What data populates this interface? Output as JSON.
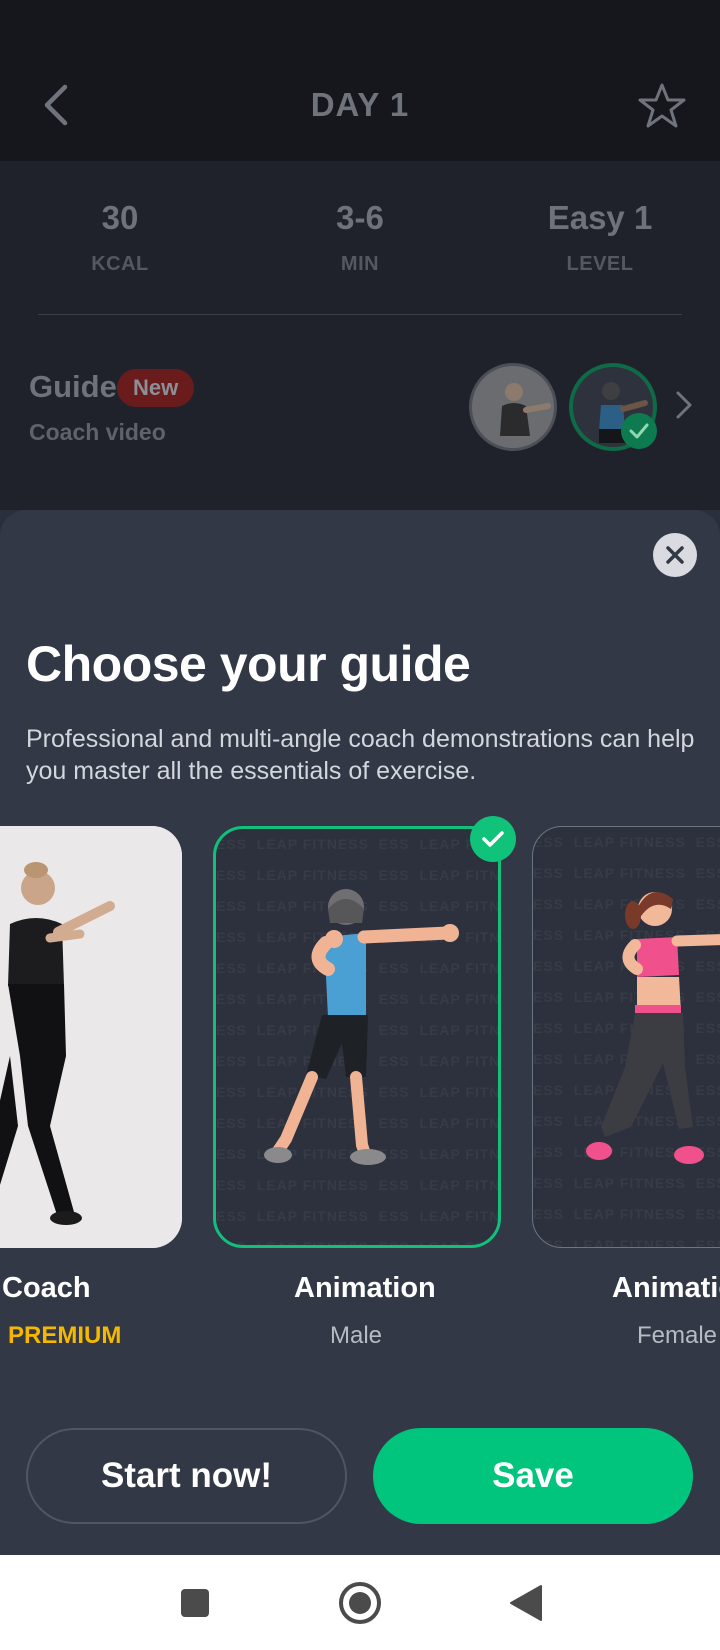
{
  "header": {
    "title": "DAY 1",
    "back_icon": "chevron-left-icon",
    "favorite_icon": "star-outline-icon"
  },
  "stats": [
    {
      "value": "30",
      "label": "KCAL"
    },
    {
      "value": "3-6",
      "label": "MIN"
    },
    {
      "value": "Easy 1",
      "label": "LEVEL"
    }
  ],
  "guide": {
    "title": "Guide",
    "badge": "New",
    "subtitle": "Coach video"
  },
  "sheet": {
    "title": "Choose your guide",
    "description": "Professional and multi-angle coach demonstrations can help you master all the essentials of exercise.",
    "watermark_text": "LEAP FITNESS",
    "options": [
      {
        "title": "Coach",
        "subtitle": "PREMIUM",
        "selected": false
      },
      {
        "title": "Animation",
        "subtitle": "Male",
        "selected": true
      },
      {
        "title": "Animation",
        "subtitle": "Female",
        "selected": false
      }
    ],
    "start_label": "Start now!",
    "save_label": "Save"
  },
  "colors": {
    "accent": "#01c47d",
    "premium": "#f5b800",
    "badge": "#6a1c1d"
  },
  "navbar": {
    "icons": [
      "recent-apps-icon",
      "home-icon",
      "back-triangle-icon"
    ]
  }
}
